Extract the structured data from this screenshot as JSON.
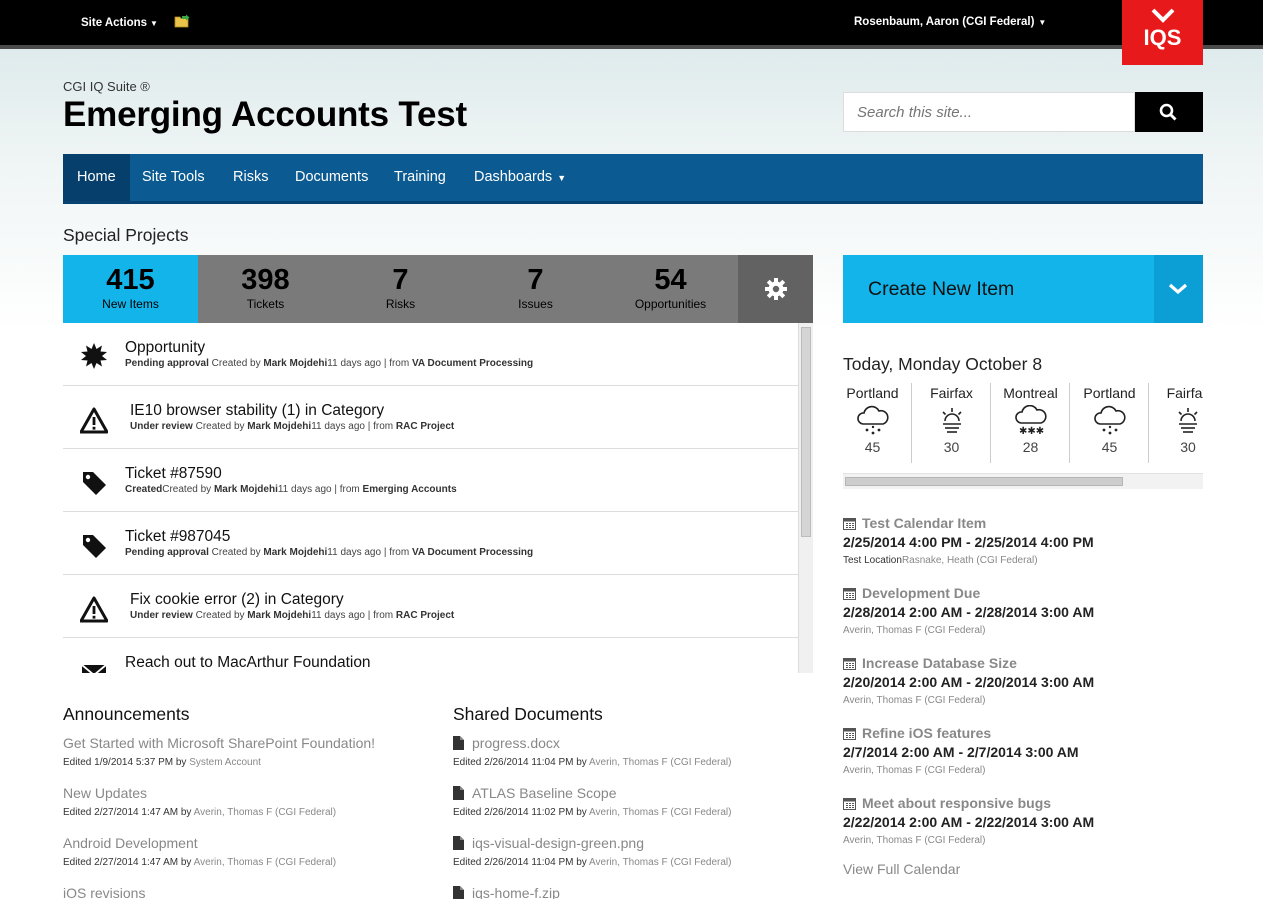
{
  "topbar": {
    "site_actions": "Site Actions",
    "user": "Rosenbaum, Aaron (CGI Federal)",
    "logo_text": "IQS",
    "logo_color": "#e8191b"
  },
  "header": {
    "suite": "CGI IQ Suite ®",
    "title": "Emerging Accounts Test",
    "search_placeholder": "Search this site..."
  },
  "nav": {
    "items": [
      "Home",
      "Site Tools",
      "Risks",
      "Documents",
      "Training",
      "Dashboards"
    ],
    "active": "Home",
    "color": "#0b5a91"
  },
  "special_projects": {
    "title": "Special Projects",
    "stats": [
      {
        "value": "415",
        "label": "New Items"
      },
      {
        "value": "398",
        "label": "Tickets"
      },
      {
        "value": "7",
        "label": "Risks"
      },
      {
        "value": "7",
        "label": "Issues"
      },
      {
        "value": "54",
        "label": "Opportunities"
      }
    ],
    "accent": "#12b4ea",
    "feed": [
      {
        "icon": "burst-icon",
        "title": "Opportunity",
        "status": "Pending approval",
        "created": " Created by ",
        "author": "Mark Mojdehi",
        "age": "11 days ago | from ",
        "source": "VA Document Processing"
      },
      {
        "icon": "warning-icon",
        "title": "IE10 browser stability (1) in Category",
        "status": "Under review",
        "created": " Created by ",
        "author": "Mark Mojdehi",
        "age": "11 days ago | from ",
        "source": "RAC Project"
      },
      {
        "icon": "tag-icon",
        "title": "Ticket #87590",
        "status": "Created",
        "created": "Created by ",
        "author": "Mark Mojdehi",
        "age": "11 days ago | from ",
        "source": "Emerging Accounts"
      },
      {
        "icon": "tag-icon",
        "title": "Ticket #987045",
        "status": "Pending approval",
        "created": " Created by ",
        "author": "Mark Mojdehi",
        "age": "11 days ago | from ",
        "source": "VA Document Processing"
      },
      {
        "icon": "warning-icon",
        "title": "Fix cookie error (2) in Category",
        "status": "Under review",
        "created": " Created by ",
        "author": "Mark Mojdehi",
        "age": "11 days ago | from ",
        "source": "RAC Project"
      },
      {
        "icon": "envelope-icon",
        "title": "Reach out to MacArthur Foundation",
        "status": "",
        "created": "",
        "author": "",
        "age": "",
        "source": ""
      }
    ]
  },
  "create": {
    "label": "Create New Item"
  },
  "weather": {
    "today": "Today, Monday October 8",
    "cities": [
      {
        "name": "Portland",
        "icon": "rain-icon",
        "temp": "45"
      },
      {
        "name": "Fairfax",
        "icon": "sunrise-icon",
        "temp": "30"
      },
      {
        "name": "Montreal",
        "icon": "snow-icon",
        "temp": "28"
      },
      {
        "name": "Portland",
        "icon": "rain-icon",
        "temp": "45"
      },
      {
        "name": "Fairfax",
        "icon": "sunrise-icon",
        "temp": "30"
      }
    ]
  },
  "calendar": {
    "items": [
      {
        "title": "Test Calendar Item",
        "range": "2/25/2014 4:00 PM - 2/25/2014 4:00 PM",
        "location": "Test Location",
        "person": "Rasnake, Heath (CGI Federal)"
      },
      {
        "title": "Development Due",
        "range": "2/28/2014 2:00 AM - 2/28/2014 3:00 AM",
        "location": "",
        "person": "Averin, Thomas F (CGI Federal)"
      },
      {
        "title": "Increase Database Size",
        "range": "2/20/2014 2:00 AM - 2/20/2014 3:00 AM",
        "location": "",
        "person": "Averin, Thomas F (CGI Federal)"
      },
      {
        "title": "Refine iOS features",
        "range": "2/7/2014 2:00 AM - 2/7/2014 3:00 AM",
        "location": "",
        "person": "Averin, Thomas F (CGI Federal)"
      },
      {
        "title": "Meet about responsive bugs",
        "range": "2/22/2014 2:00 AM - 2/22/2014 3:00 AM",
        "location": "",
        "person": "Averin, Thomas F (CGI Federal)"
      }
    ],
    "view_all": "View Full Calendar"
  },
  "announcements": {
    "title": "Announcements",
    "items": [
      {
        "title": "Get Started with Microsoft SharePoint Foundation!",
        "edited": "Edited 1/9/2014 5:37 PM by ",
        "by": "System Account"
      },
      {
        "title": "New Updates",
        "edited": "Edited 2/27/2014 1:47 AM by ",
        "by": "Averin, Thomas F (CGI Federal)"
      },
      {
        "title": "Android Development",
        "edited": "Edited 2/27/2014 1:47 AM by ",
        "by": "Averin, Thomas F (CGI Federal)"
      },
      {
        "title": "iOS revisions",
        "edited": "",
        "by": ""
      }
    ]
  },
  "shared_documents": {
    "title": "Shared Documents",
    "items": [
      {
        "title": "progress.docx",
        "edited": "Edited 2/26/2014 11:04 PM by ",
        "by": "Averin, Thomas F (CGI Federal)"
      },
      {
        "title": "ATLAS Baseline Scope",
        "edited": "Edited 2/26/2014 11:02 PM by ",
        "by": "Averin, Thomas F (CGI Federal)"
      },
      {
        "title": "iqs-visual-design-green.png",
        "edited": "Edited 2/26/2014 11:04 PM by ",
        "by": "Averin, Thomas F (CGI Federal)"
      },
      {
        "title": "iqs-home-f.zip",
        "edited": "",
        "by": ""
      }
    ]
  }
}
